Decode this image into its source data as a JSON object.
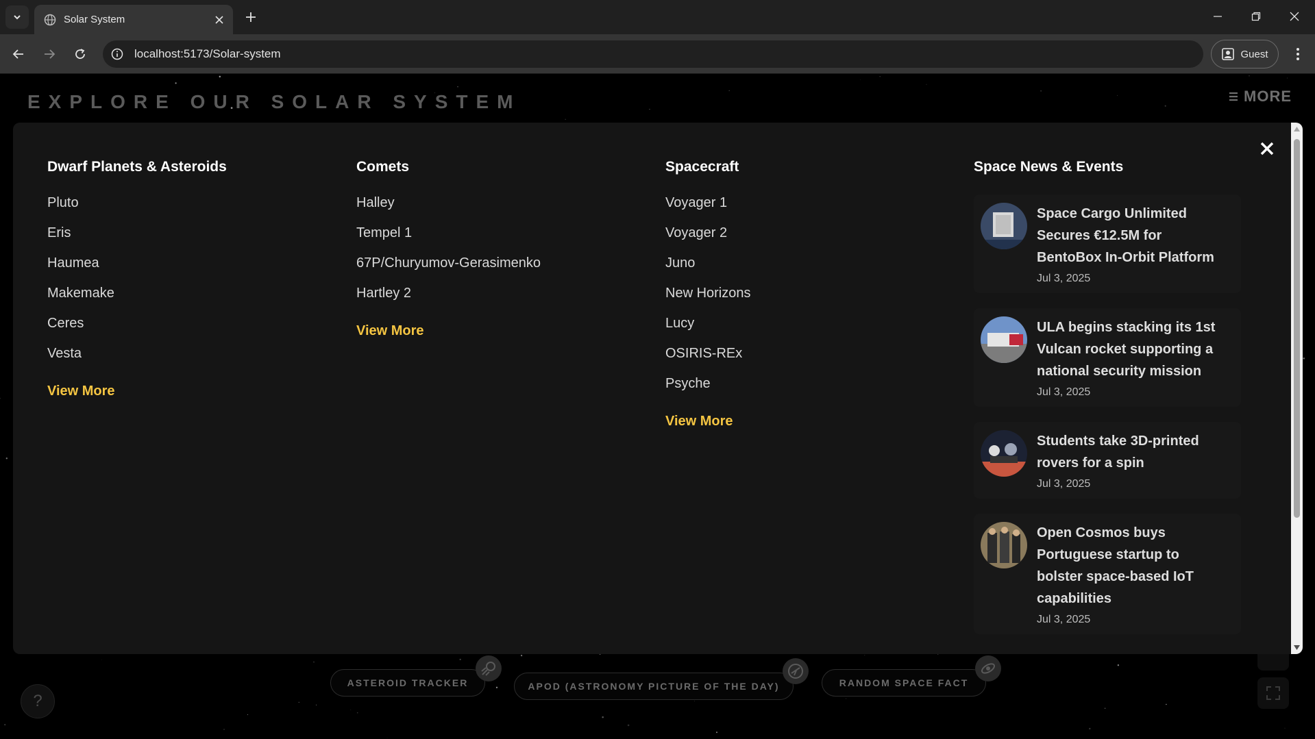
{
  "browser": {
    "tab_title": "Solar System",
    "url": "localhost:5173/Solar-system",
    "profile_label": "Guest"
  },
  "page": {
    "title": "EXPLORE OUR SOLAR SYSTEM",
    "more_label": "MORE",
    "bottom_buttons": [
      "ASTEROID TRACKER",
      "APOD (ASTRONOMY PICTURE OF THE DAY)",
      "RANDOM SPACE FACT"
    ],
    "help_label": "?"
  },
  "menu": {
    "columns": [
      {
        "title": "Dwarf Planets & Asteroids",
        "items": [
          "Pluto",
          "Eris",
          "Haumea",
          "Makemake",
          "Ceres",
          "Vesta"
        ],
        "view_more": "View More"
      },
      {
        "title": "Comets",
        "items": [
          "Halley",
          "Tempel 1",
          "67P/Churyumov-Gerasimenko",
          "Hartley 2"
        ],
        "view_more": "View More"
      },
      {
        "title": "Spacecraft",
        "items": [
          "Voyager 1",
          "Voyager 2",
          "Juno",
          "New Horizons",
          "Lucy",
          "OSIRIS-REx",
          "Psyche"
        ],
        "view_more": "View More"
      }
    ],
    "news": {
      "title": "Space News & Events",
      "items": [
        {
          "title": "Space Cargo Unlimited Secures €12.5M for BentoBox In-Orbit Platform",
          "date": "Jul 3, 2025"
        },
        {
          "title": "ULA begins stacking its 1st Vulcan rocket supporting a national security mission",
          "date": "Jul 3, 2025"
        },
        {
          "title": "Students take 3D-printed rovers for a spin",
          "date": "Jul 3, 2025"
        },
        {
          "title": "Open Cosmos buys Portuguese startup to bolster space-based IoT capabilities",
          "date": "Jul 3, 2025"
        }
      ]
    }
  },
  "colors": {
    "accent": "#f5c542",
    "menu_bg": "#151515",
    "page_bg": "#000000"
  }
}
